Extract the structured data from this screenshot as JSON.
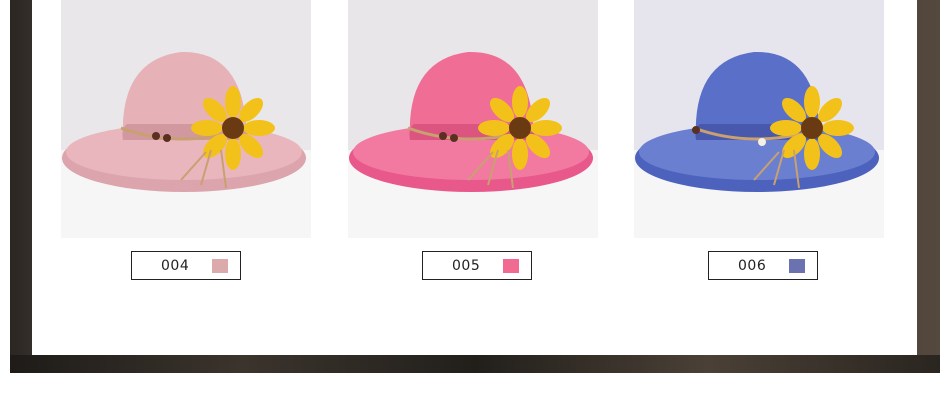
{
  "products": [
    {
      "code": "004",
      "swatch": "#dca9ad",
      "hat": "#e7b1b8",
      "hatShade": "#d298a0",
      "bg": "#e9e7ea"
    },
    {
      "code": "005",
      "swatch": "#f06a91",
      "hat": "#f06d96",
      "hatShade": "#dc5480",
      "bg": "#e8e6e8"
    },
    {
      "code": "006",
      "swatch": "#6b72b0",
      "hat": "#5a6fc8",
      "hatShade": "#4859ad",
      "bg": "#e6e5ee"
    }
  ]
}
